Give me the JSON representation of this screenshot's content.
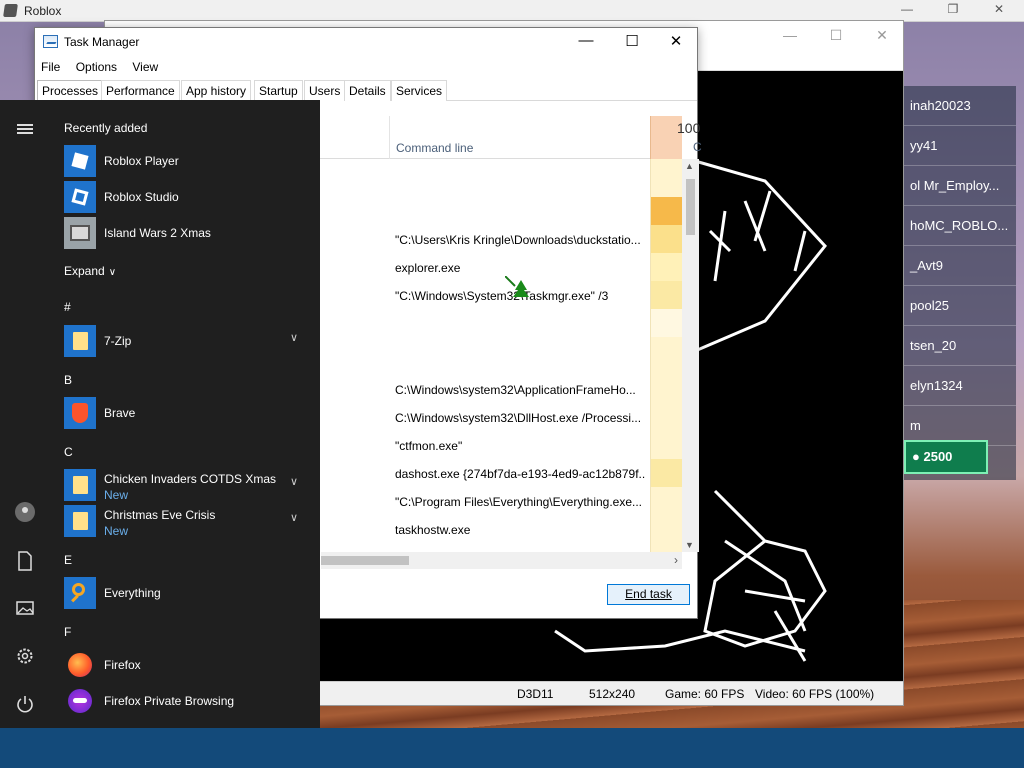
{
  "roblox": {
    "title": "Roblox",
    "leaderboard": [
      "inah20023",
      "yy41",
      "ol Mr_Employ...",
      "hoMC_ROBLO...",
      "_Avt9",
      "pool25",
      "tsen_20",
      "elyn1324",
      "m"
    ],
    "robux": "2500",
    "controls": {
      "minimize": "—",
      "restore": "❐",
      "close": "✕"
    }
  },
  "duckstation": {
    "controls": {
      "minimize": "—",
      "maximize": "☐",
      "close": "✕"
    },
    "status": {
      "renderer": "D3D11",
      "resolution": "512x240",
      "game_fps": "Game: 60 FPS",
      "video_fps": "Video: 60 FPS (100%)"
    }
  },
  "task_manager": {
    "title": "Task Manager",
    "controls": {
      "minimize": "—",
      "maximize": "☐",
      "close": "✕"
    },
    "menu": [
      "File",
      "Options",
      "View"
    ],
    "tabs": [
      "Processes",
      "Performance",
      "App history",
      "Startup",
      "Users",
      "Details",
      "Services"
    ],
    "active_tab": "Processes",
    "columns": {
      "command_line": "Command line",
      "cpu_percent": "100",
      "cpu_label": "C"
    },
    "rows": [
      "\"C:\\Users\\Kris Kringle\\Downloads\\duckstatio...",
      "explorer.exe",
      "\"C:\\Windows\\System32\\Taskmgr.exe\" /3",
      "C:\\Windows\\system32\\ApplicationFrameHo...",
      "C:\\Windows\\system32\\DllHost.exe /Processi...",
      "\"ctfmon.exe\"",
      "dashost.exe {274bf7da-e193-4ed9-ac12b879f...",
      "\"C:\\Program Files\\Everything\\Everything.exe...",
      "taskhostw.exe"
    ],
    "end_task_label": "End task",
    "colors": {
      "cpu_high": "#f6b94a",
      "cpu_mid": "#fbe08b",
      "cpu_low": "#fff4cf",
      "header_cpu": "#f9d2b4"
    }
  },
  "start_menu": {
    "recently_added_label": "Recently added",
    "recent_apps": [
      "Roblox Player",
      "Roblox Studio",
      "Island Wars 2 Xmas"
    ],
    "expand_label": "Expand",
    "sections": [
      {
        "letter": "#",
        "apps": [
          {
            "name": "7-Zip",
            "sub": "",
            "expandable": true,
            "icon": "folder-icon"
          }
        ]
      },
      {
        "letter": "B",
        "apps": [
          {
            "name": "Brave",
            "sub": "",
            "expandable": false,
            "icon": "brave-icon"
          }
        ]
      },
      {
        "letter": "C",
        "apps": [
          {
            "name": "Chicken Invaders COTDS Xmas",
            "sub": "New",
            "expandable": true,
            "icon": "folder-icon"
          },
          {
            "name": "Christmas Eve Crisis",
            "sub": "New",
            "expandable": true,
            "icon": "folder-icon"
          }
        ]
      },
      {
        "letter": "E",
        "apps": [
          {
            "name": "Everything",
            "sub": "",
            "expandable": false,
            "icon": "everything-icon"
          }
        ]
      },
      {
        "letter": "F",
        "apps": [
          {
            "name": "Firefox",
            "sub": "",
            "expandable": false,
            "icon": "firefox-icon"
          },
          {
            "name": "Firefox Private Browsing",
            "sub": "",
            "expandable": false,
            "icon": "firefox-private-icon"
          }
        ]
      }
    ],
    "rail_icons": [
      "hamburger-icon",
      "user-avatar-icon",
      "document-icon",
      "pictures-icon",
      "settings-icon",
      "power-icon"
    ]
  }
}
